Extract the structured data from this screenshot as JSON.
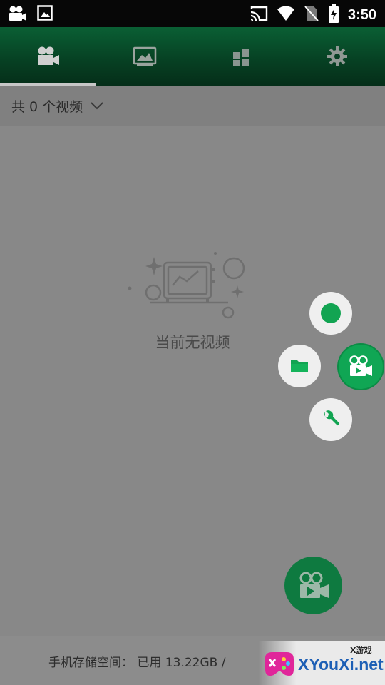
{
  "status_bar": {
    "time": "3:50",
    "left_icons": [
      "camera-icon",
      "image-icon"
    ],
    "right_icons": [
      "cast-icon",
      "wifi-icon",
      "no-sim-icon",
      "battery-charging-icon"
    ]
  },
  "tabs": [
    {
      "icon": "video-camera-icon",
      "active": true
    },
    {
      "icon": "image-gallery-icon",
      "active": false
    },
    {
      "icon": "grid-tools-icon",
      "active": false
    },
    {
      "icon": "settings-gear-icon",
      "active": false
    }
  ],
  "filter": {
    "label": "共 0 个视频",
    "icon": "chevron-down-icon"
  },
  "empty_state": {
    "message": "当前无视频"
  },
  "floating_menu": {
    "items": [
      "record-dot",
      "folder-icon",
      "wrench-icon",
      "video-camera-icon"
    ]
  },
  "storage": {
    "text": "手机存储空间： 已用 13.22GB / "
  },
  "watermark": {
    "tag": "X游戏",
    "text": "XYouXi.net"
  },
  "colors": {
    "accent": "#12a452",
    "header_dark": "#063f22",
    "overlay_gray": "#888888"
  }
}
